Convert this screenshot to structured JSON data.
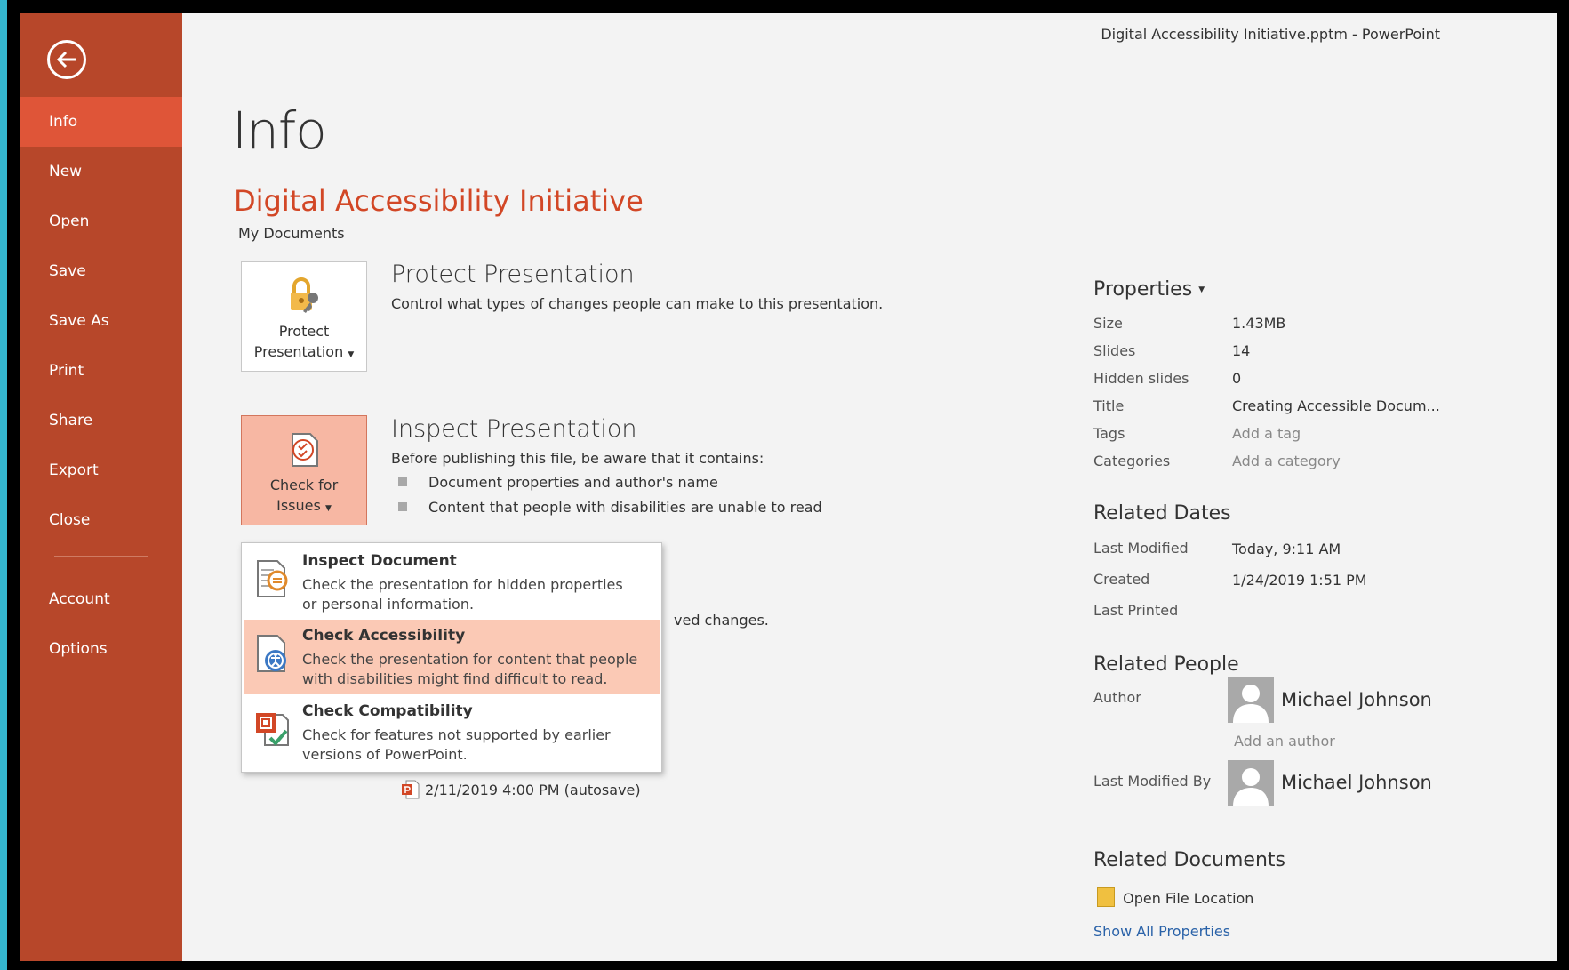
{
  "window": {
    "title": "Digital Accessibility  Initiative.pptm - PowerPoint"
  },
  "sidebar": {
    "back_icon": "back-arrow-icon",
    "items": [
      {
        "label": "Info",
        "active": true
      },
      {
        "label": "New"
      },
      {
        "label": "Open"
      },
      {
        "label": "Save"
      },
      {
        "label": "Save As"
      },
      {
        "label": "Print"
      },
      {
        "label": "Share"
      },
      {
        "label": "Export"
      },
      {
        "label": "Close"
      },
      {
        "label": "Account"
      },
      {
        "label": "Options"
      }
    ]
  },
  "main": {
    "page_title": "Info",
    "doc_title": "Digital Accessibility  Initiative",
    "doc_location": "My Documents",
    "protect": {
      "button_line1": "Protect",
      "button_line2": "Presentation",
      "heading": "Protect Presentation",
      "description": "Control what types of changes people can make to this presentation."
    },
    "inspect": {
      "button_line1": "Check for",
      "button_line2": "Issues",
      "heading": "Inspect Presentation",
      "description": "Before publishing this file, be aware that it contains:",
      "bullets": [
        "Document properties and author's name",
        "Content that people with disabilities are unable to read"
      ]
    },
    "partial_text": "ved changes.",
    "dropdown": {
      "items": [
        {
          "title": "Inspect Document",
          "desc1": "Check the presentation for hidden properties",
          "desc2": "or personal information."
        },
        {
          "title": "Check Accessibility",
          "desc1": "Check the presentation for content that people",
          "desc2": "with disabilities might find difficult to read.",
          "hover": true
        },
        {
          "title": "Check Compatibility",
          "desc1": "Check for features not supported by earlier",
          "desc2": "versions of PowerPoint."
        }
      ]
    },
    "autosave": "2/11/2019 4:00 PM (autosave)"
  },
  "properties": {
    "heading": "Properties",
    "rows": [
      {
        "label": "Size",
        "value": "1.43MB"
      },
      {
        "label": "Slides",
        "value": "14"
      },
      {
        "label": "Hidden slides",
        "value": "0"
      },
      {
        "label": "Title",
        "value": "Creating Accessible Docum..."
      },
      {
        "label": "Tags",
        "value": "Add a tag"
      },
      {
        "label": "Categories",
        "value": "Add a category"
      }
    ],
    "related_dates": {
      "heading": "Related Dates",
      "rows": [
        {
          "label": "Last Modified",
          "value": "Today, 9:11 AM"
        },
        {
          "label": "Created",
          "value": "1/24/2019 1:51 PM"
        },
        {
          "label": "Last Printed",
          "value": ""
        }
      ]
    },
    "related_people": {
      "heading": "Related People",
      "author_label": "Author",
      "author_name": "Michael Johnson",
      "add_author": "Add an author",
      "modified_by_label": "Last Modified By",
      "modified_by_name": "Michael Johnson"
    },
    "related_documents": {
      "heading": "Related Documents",
      "open_location": "Open File Location",
      "show_all": "Show All Properties"
    }
  },
  "colors": {
    "sidebar": "#b7472a",
    "active": "#df5538",
    "accent_title": "#d24726",
    "hover": "#fbc9b5",
    "link": "#2a62a8"
  }
}
